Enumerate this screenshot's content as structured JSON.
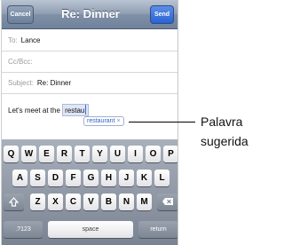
{
  "nav": {
    "title": "Re: Dinner",
    "cancel_label": "Cancel",
    "send_label": "Send"
  },
  "fields": {
    "to_label": "To:",
    "to_value": "Lance",
    "cc_label": "Cc/Bcc:",
    "subject_label": "Subject:",
    "subject_value": "Re: Dinner"
  },
  "body": {
    "text_before": "Let's meet at the",
    "typed_word": "restau",
    "suggestion": "restaurant",
    "suggestion_close": "×"
  },
  "keyboard": {
    "row1": [
      "Q",
      "W",
      "E",
      "R",
      "T",
      "Y",
      "U",
      "I",
      "O",
      "P"
    ],
    "row2": [
      "A",
      "S",
      "D",
      "F",
      "G",
      "H",
      "J",
      "K",
      "L"
    ],
    "row3": [
      "Z",
      "X",
      "C",
      "V",
      "B",
      "N",
      "M"
    ],
    "numbers_label": ".?123",
    "space_label": "space",
    "return_label": "return",
    "shift_icon": "shift-arrow-icon",
    "delete_icon": "backspace-icon"
  },
  "callout": {
    "line1": "Palavra",
    "line2": "sugerida"
  }
}
